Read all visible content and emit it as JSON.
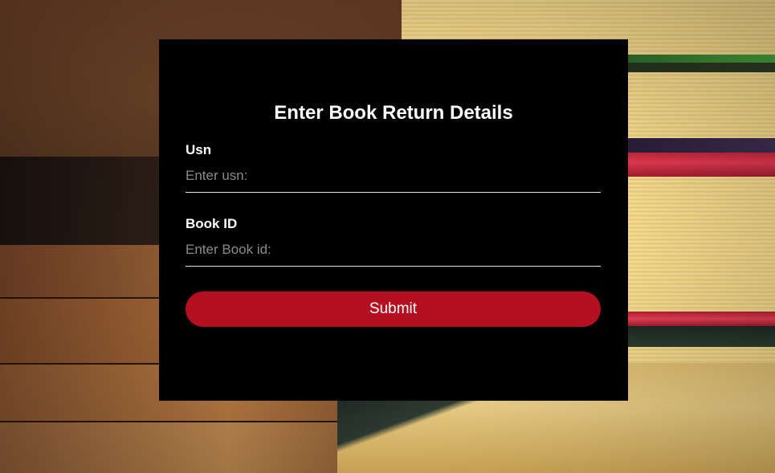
{
  "form": {
    "title": "Enter Book Return Details",
    "usn": {
      "label": "Usn",
      "placeholder": "Enter usn:",
      "value": ""
    },
    "book_id": {
      "label": "Book ID",
      "placeholder": "Enter Book id:",
      "value": ""
    },
    "submit_label": "Submit"
  },
  "colors": {
    "card_background": "#000000",
    "submit_button": "#b50f22",
    "text": "#ffffff",
    "placeholder": "#8a8a8a"
  },
  "background": {
    "image": "books-on-wooden-table-photo"
  }
}
